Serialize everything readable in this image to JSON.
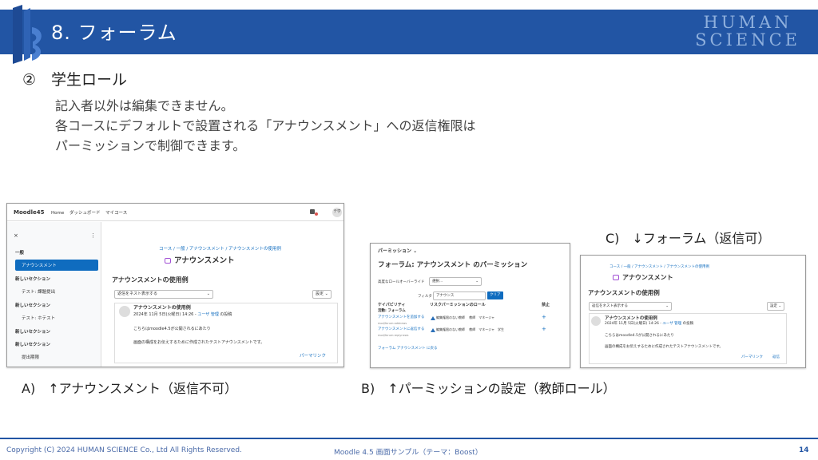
{
  "header": {
    "title": "8. フォーラム",
    "brand_line1": "HUMAN",
    "brand_line2": "SCIENCE",
    "color": "#2255a4"
  },
  "section": {
    "number": "②",
    "title": "学生ロール"
  },
  "description": [
    "記入者以外は編集できません。",
    "各コースにデフォルトで設置される「アナウンスメント」への返信権限は",
    "パーミッションで制御できます。"
  ],
  "captions": {
    "a": "A)　↑アナウンスメント（返信不可）",
    "b": "B)　↑パーミッションの設定（教師ロール）",
    "c": "C)　↓フォーラム（返信可）"
  },
  "shot_a": {
    "navbar": {
      "brand": "Moodle45",
      "links": [
        "Home",
        "ダッシュボード",
        "マイコース"
      ],
      "avatar": "テ学",
      "chevron": "⌄"
    },
    "drawer": {
      "close": "×",
      "menu": "⋮",
      "items": [
        {
          "label": "一般",
          "type": "section"
        },
        {
          "label": "アナウンスメント",
          "type": "active"
        },
        {
          "label": "新しいセクション",
          "type": "section"
        },
        {
          "label": "テスト: 課題提出",
          "type": "item"
        },
        {
          "label": "新しいセクション",
          "type": "section"
        },
        {
          "label": "テスト: ホテスト",
          "type": "item"
        },
        {
          "label": "新しいセクション",
          "type": "section"
        },
        {
          "label": "新しいセクション",
          "type": "section"
        },
        {
          "label": "提出期限",
          "type": "item"
        }
      ]
    },
    "breadcrumb": "コース / 一般 / アナウンスメント / アナウンスメントの使用例",
    "page_title": "アナウンスメント",
    "discussion_title": "アナウンスメントの使用例",
    "select": "返信をネスト表示する",
    "settings": "設定 ⌄",
    "post": {
      "subject": "アナウンスメントの使用例",
      "meta_prefix": "2024年 11月 5日(火曜日) 14:26 - ",
      "author": "ユーザ 管理",
      "meta_suffix": " の投稿",
      "body1": "こちらはmoodle4.5が公開されるにあたり",
      "body2": "画面の構成をお伝えするために作成されたテストアナウンスメントです。",
      "permalink": "パーマリンク"
    }
  },
  "shot_b": {
    "header": "パーミッション ⌄",
    "title": "フォーラム: アナウンスメント のパーミッション",
    "override_label": "高度なロールオーバーライド",
    "override_value": "選択...",
    "filter_label": "フィルタ",
    "filter_value": "アナウンス",
    "clear": "クリア",
    "col_capability": "ケイパビリティ",
    "col_roles": "リスクパーミッションのロール",
    "col_prohibit": "禁止",
    "group_label": "活動: フォーラム",
    "rows": [
      {
        "name": "アナウンスメントを追加する",
        "code": "mod/forum:addnews",
        "roles": "編集権限のない教師 　教師　マネージャ"
      },
      {
        "name": "アナウンスメントに返信する",
        "code": "mod/forum:replynews",
        "roles": "編集権限のない教師 　教師　マネージャ　学生"
      }
    ],
    "back": "フォーラム アナウンスメント に戻る"
  },
  "shot_c": {
    "breadcrumb": "コース / 一般 / アナウンスメント / アナウンスメントの使用例",
    "page_title": "アナウンスメント",
    "discussion_title": "アナウンスメントの使用例",
    "select": "返信をネスト表示する",
    "settings": "設定 ⌄",
    "post": {
      "subject": "アナウンスメントの使用例",
      "meta_prefix": "2024年 11月 5日(火曜日) 14:26 - ",
      "author": "ユーザ 管理",
      "meta_suffix": " の投稿",
      "body1": "こちらはmoodle4.5が公開されるにあたり",
      "body2": "画面の構成をお伝えするために作成されたテストアナウンスメントです。",
      "permalink": "パーマリンク",
      "reply": "返信"
    }
  },
  "footer": {
    "copyright": "Copyright (C) 2024 HUMAN SCIENCE Co., Ltd All Rights Reserved.",
    "center": "Moodle 4.5 画面サンプル（テーマ：Boost）",
    "page": "14"
  }
}
